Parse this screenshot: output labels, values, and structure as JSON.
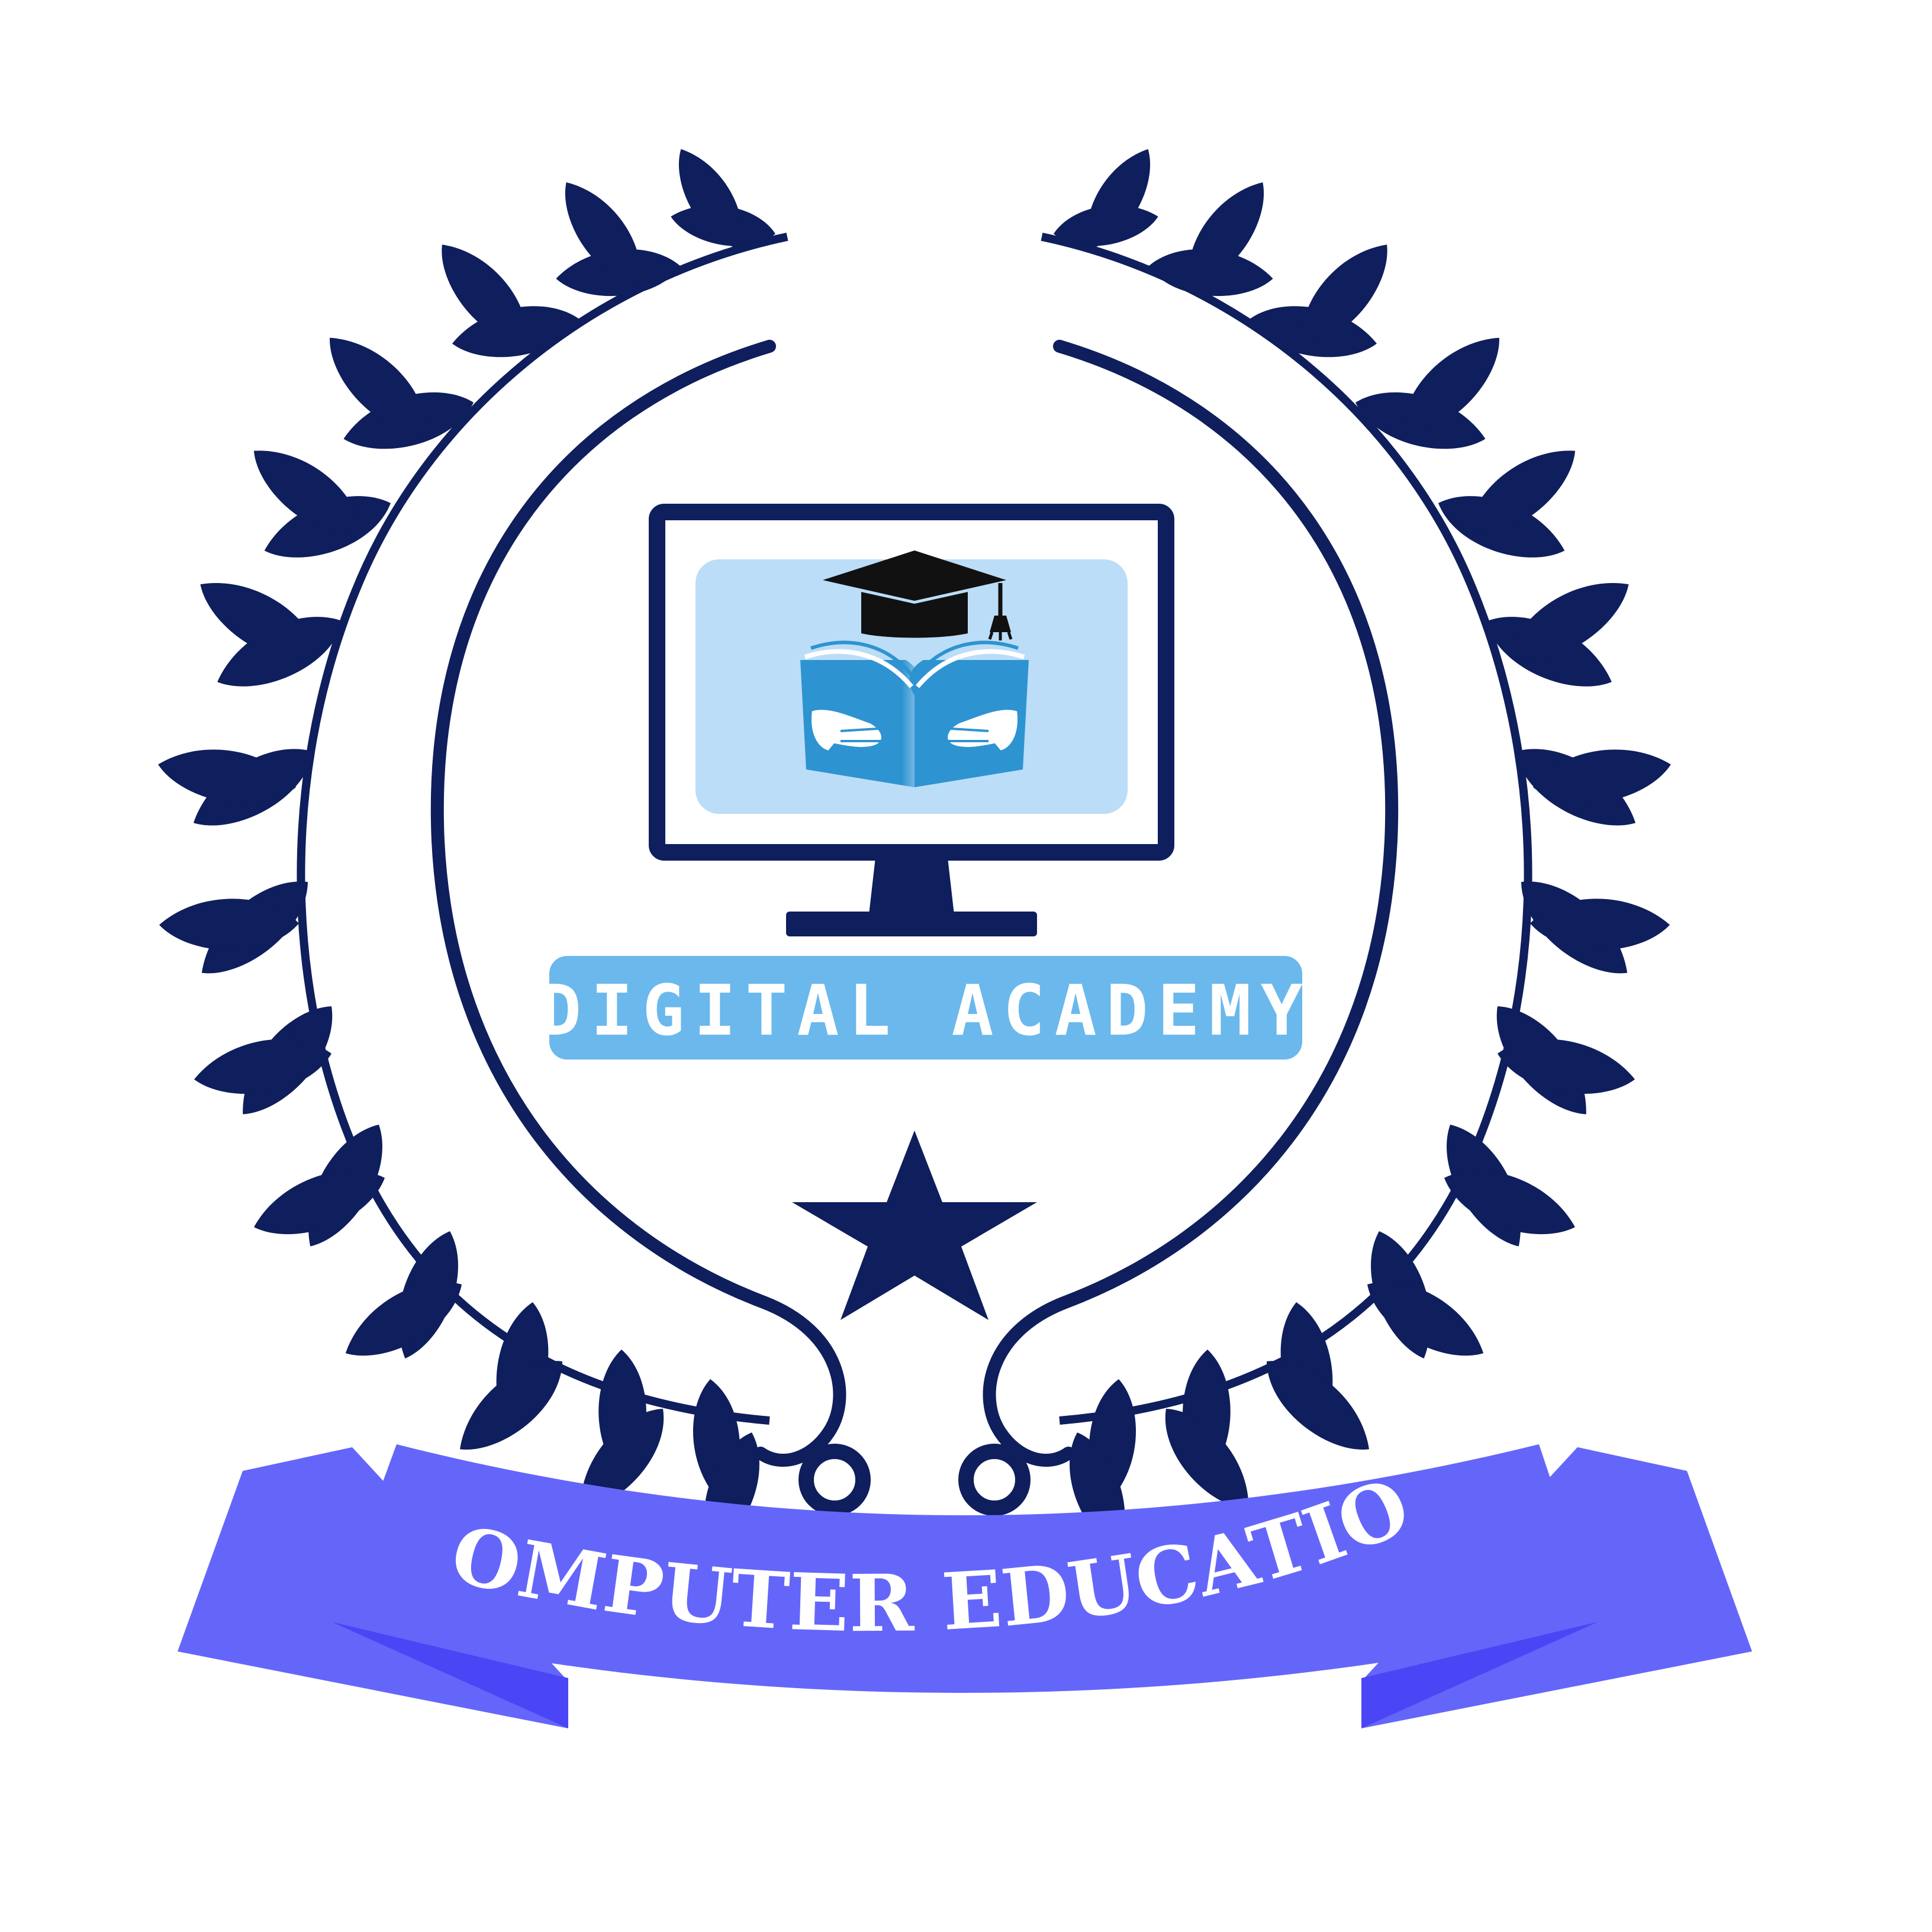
{
  "logo": {
    "academy_name": "DIGITAL ACADEMY",
    "ribbon_text": "COMPUTER EDUCATION",
    "icons": [
      "laurel-wreath-icon",
      "monitor-icon",
      "graduation-cap-icon",
      "open-book-icon",
      "hands-icon",
      "star-icon",
      "ribbon-banner-icon"
    ],
    "colors": {
      "navy": "#0F1E5C",
      "light_blue": "#BBDDF7",
      "sky_blue": "#6BB8EC",
      "book_blue": "#2E93D1",
      "ribbon": "#6466FA",
      "ribbon_dark": "#4A46F5",
      "background": "#FFFFFF"
    }
  }
}
